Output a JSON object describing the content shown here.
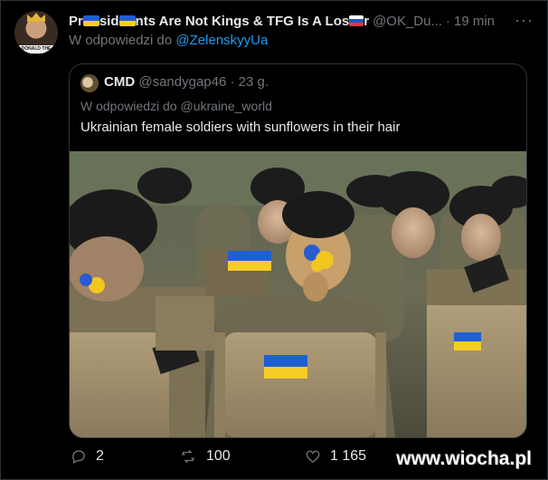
{
  "tweet": {
    "author_name_parts": [
      "Pr",
      "sid",
      "nts Are Not Kings & TFG Is A Los",
      "r"
    ],
    "handle": "@OK_Du...",
    "time": "19 min",
    "reply_prefix": "W odpowiedzi do",
    "reply_to": "@ZelenskyyUa",
    "avatar_caption": "DONALD THE"
  },
  "quoted": {
    "name": "CMD",
    "handle": "@sandygap46",
    "time": "23 g.",
    "reply_line": "W odpowiedzi do @ukraine_world",
    "text": "Ukrainian female soldiers with sunflowers in their hair"
  },
  "actions": {
    "replies": "2",
    "retweets": "100",
    "likes": "1 165"
  },
  "watermark": "www.wiocha.pl",
  "colors": {
    "background": "#000000",
    "text": "#e7e9ea",
    "muted": "#71767b",
    "link": "#1d9bf0",
    "border": "#2f3336"
  },
  "icons": [
    "more-icon",
    "reply-icon",
    "retweet-icon",
    "like-icon"
  ]
}
